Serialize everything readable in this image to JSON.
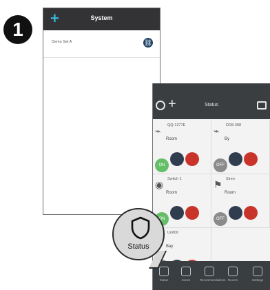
{
  "step": {
    "number": "1"
  },
  "phone1": {
    "header": {
      "add_icon": "+",
      "title": "System"
    },
    "items": [
      {
        "label": "Demo Set A"
      }
    ]
  },
  "phone2": {
    "header": {
      "title": "Status"
    },
    "devices": [
      {
        "name": "QQ-1277E",
        "room": "Room",
        "buttons": [
          "ON",
          "",
          ""
        ]
      },
      {
        "name": "DD8-398",
        "room": "By",
        "buttons": [
          "OFF",
          "",
          ""
        ]
      },
      {
        "name": "Switch 1",
        "room": "Room",
        "buttons": [
          "ON",
          "",
          ""
        ]
      },
      {
        "name": "Siren",
        "room": "Room",
        "buttons": [
          "OFF",
          "",
          ""
        ]
      },
      {
        "name": "Unit00",
        "room": "Bay",
        "buttons": [
          "",
          "",
          ""
        ]
      }
    ],
    "tabs": [
      "Status",
      "Zones",
      "Recommendations",
      "Rooms",
      "Settings"
    ]
  },
  "callout": {
    "label": "Status"
  },
  "colors": {
    "accent": "#39b4d6",
    "on": "#64bf68",
    "off": "#8b8b8b",
    "danger": "#c9342a"
  }
}
